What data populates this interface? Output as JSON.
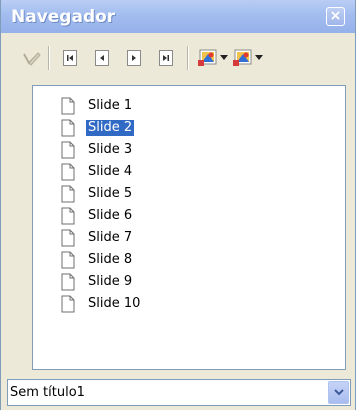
{
  "window": {
    "title": "Navegador",
    "close_glyph": "×"
  },
  "toolbar": {
    "buttons": [
      {
        "name": "pointer-icon"
      },
      {
        "name": "first-slide-icon"
      },
      {
        "name": "previous-slide-icon"
      },
      {
        "name": "next-slide-icon"
      },
      {
        "name": "last-slide-icon"
      },
      {
        "name": "drag-mode-icon"
      },
      {
        "name": "shapes-icon"
      }
    ]
  },
  "slides": {
    "items": [
      {
        "label": "Slide 1",
        "selected": false
      },
      {
        "label": "Slide 2",
        "selected": true
      },
      {
        "label": "Slide 3",
        "selected": false
      },
      {
        "label": "Slide 4",
        "selected": false
      },
      {
        "label": "Slide 5",
        "selected": false
      },
      {
        "label": "Slide 6",
        "selected": false
      },
      {
        "label": "Slide 7",
        "selected": false
      },
      {
        "label": "Slide 8",
        "selected": false
      },
      {
        "label": "Slide 9",
        "selected": false
      },
      {
        "label": "Slide 10",
        "selected": false
      }
    ]
  },
  "document_select": {
    "value": "Sem título1"
  },
  "colors": {
    "title_bar": "#a3bdef",
    "selection": "#316ac5"
  }
}
